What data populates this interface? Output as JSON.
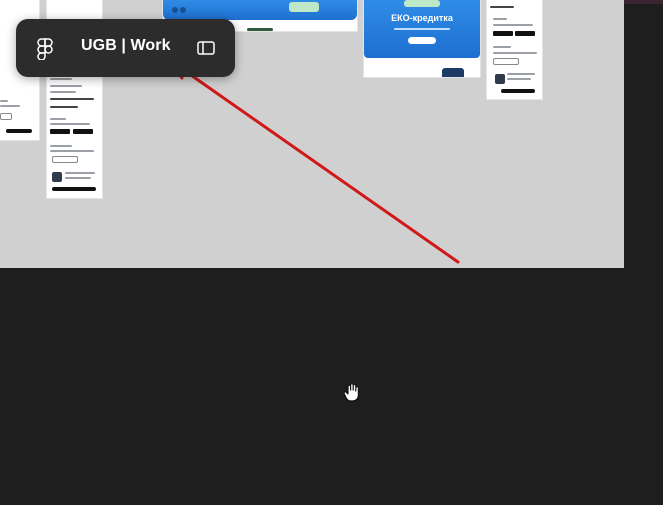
{
  "toolbar": {
    "logo_icon": "figma-logo-icon",
    "file_name": "UGB | Work",
    "sidebar_toggle_icon": "sidebar-panel-icon"
  },
  "canvas": {
    "banner_title": "ЕКО-кредитка"
  },
  "annotation": {
    "arrow_color": "#d01818"
  },
  "cursor": {
    "icon": "hand-grab-icon"
  },
  "colors": {
    "app_background": "#1e1e1e",
    "canvas_background": "#d0d0d0",
    "toolbar_background": "#2c2c2c",
    "banner_blue": "#2f8ce6"
  }
}
